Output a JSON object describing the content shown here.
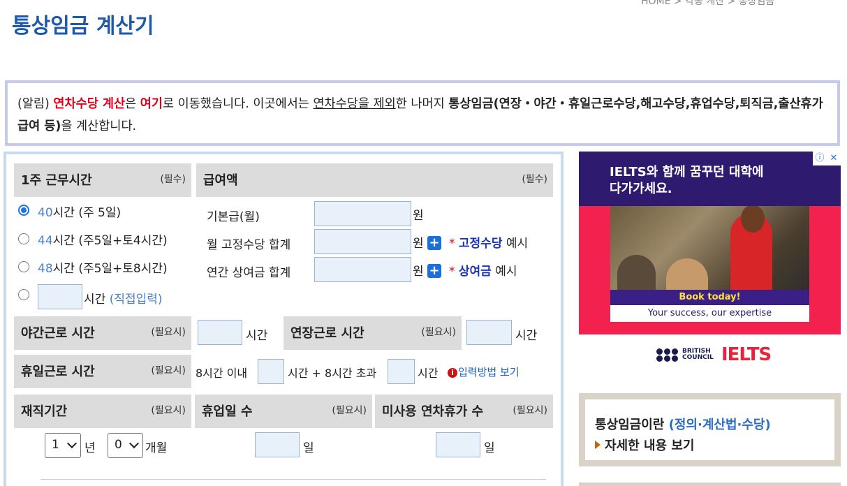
{
  "breadcrumb": "HOME  >  각종 계산  >  통상임금",
  "page_title": "통상임금 계산기",
  "notice": {
    "part1": "(알림) ",
    "red1": "연차수당 계산",
    "part2": "은 ",
    "red2": "여기",
    "part3": "로 이동했습니다. 이곳에서는 ",
    "underlined": "연차수당을 제외",
    "part4": "한 나머지 ",
    "bold": "통상임금(연장・야간・휴일근로수당,해고수당,휴업수당,퇴직금,출산휴가급여 등)",
    "part5": "을 계산합니다."
  },
  "work_hours": {
    "header": "1주 근무시간",
    "required": "(필수)",
    "options": [
      {
        "value": "40",
        "text": "시간 (주 5일)",
        "selected": true
      },
      {
        "value": "44",
        "text": "시간 (주5일+토4시간)",
        "selected": false
      },
      {
        "value": "48",
        "text": "시간 (주5일+토8시간)",
        "selected": false
      }
    ],
    "custom_unit": "시간",
    "custom_link": "(직접입력)"
  },
  "salary": {
    "header": "급여액",
    "required": "(필수)",
    "base_label": "기본급(월)",
    "fixed_label": "월 고정수당 합계",
    "bonus_label": "연간 상여금 합계",
    "unit": "원",
    "plus": "+",
    "star": "*",
    "fixed_example_bold": "고정수당",
    "bonus_example_bold": "상여금",
    "example": "예시"
  },
  "night": {
    "header": "야간근로 시간",
    "optional": "(필요시)",
    "unit": "시간"
  },
  "overtime": {
    "header": "연장근로 시간",
    "optional": "(필요시)",
    "unit": "시간"
  },
  "holiday": {
    "header": "휴일근로 시간",
    "optional": "(필요시)",
    "within": "8시간 이내",
    "plus_over": "시간 + 8시간 초과",
    "unit": "시간",
    "info_icon": "i",
    "guide_link": "입력방법 보기"
  },
  "tenure": {
    "header": "재직기간",
    "optional": "(필요시)",
    "years_value": "1",
    "years_unit": "년",
    "months_value": "0",
    "months_unit": "개월"
  },
  "leave_days": {
    "header": "휴업일 수",
    "optional": "(필요시)",
    "unit": "일"
  },
  "unused_leave": {
    "header": "미사용 연차휴가 수",
    "optional": "(필요시)",
    "unit": "일"
  },
  "ad": {
    "headline": "IELTS와 함께 꿈꾸던 대학에 다가가세요.",
    "cta": "Book today!",
    "tagline": "Your success, our expertise",
    "brand_small": "BRITISH COUNCIL",
    "brand_big": "IELTS",
    "icon_info": "ⓘ",
    "icon_close": "✕"
  },
  "sidebar_box": {
    "title": "통상임금이란 ",
    "title_link": "(정의·계산법·수당)",
    "more": "자세한 내용 보기"
  }
}
